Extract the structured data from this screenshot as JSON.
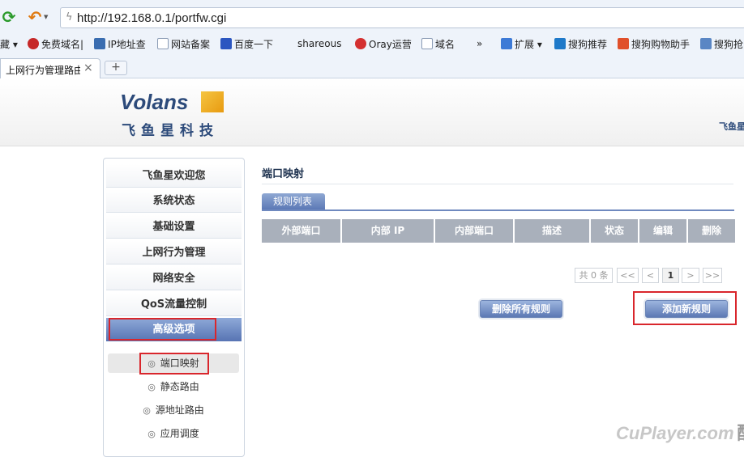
{
  "browser": {
    "url": "http://192.168.0.1/portfw.cgi",
    "bookmarks": [
      {
        "label": "藏 ▾",
        "icon": "bookmark-icon"
      },
      {
        "label": "免费域名|",
        "icon": "oray-icon"
      },
      {
        "label": "IP地址查",
        "icon": "ip-icon"
      },
      {
        "label": "网站备案",
        "icon": "page-icon"
      },
      {
        "label": "百度一下",
        "icon": "baidu-icon"
      },
      {
        "label": "shareous",
        "icon": ""
      },
      {
        "label": "Oray运营",
        "icon": "oray-icon"
      },
      {
        "label": "域名",
        "icon": "page-icon"
      },
      {
        "label": "»",
        "icon": ""
      },
      {
        "label": "扩展 ▾",
        "icon": "grid-icon"
      },
      {
        "label": "搜狗推荐",
        "icon": "search-icon"
      },
      {
        "label": "搜狗购物助手",
        "icon": "shop-icon"
      },
      {
        "label": "搜狗抢",
        "icon": "window-icon"
      }
    ],
    "tab": {
      "label": "上网行为管理路由",
      "close": "×"
    },
    "newtab": "+"
  },
  "header": {
    "logo_word": "Volans",
    "logo_cn": "飞鱼星科技",
    "right_text": "飞鱼星"
  },
  "sidebar": {
    "items": [
      {
        "label": "飞鱼星欢迎您"
      },
      {
        "label": "系统状态"
      },
      {
        "label": "基础设置"
      },
      {
        "label": "上网行为管理"
      },
      {
        "label": "网络安全"
      },
      {
        "label": "QoS流量控制"
      },
      {
        "label": "高级选项"
      }
    ],
    "sub_items": [
      {
        "label": "端口映射"
      },
      {
        "label": "静态路由"
      },
      {
        "label": "源地址路由"
      },
      {
        "label": "应用调度"
      }
    ],
    "bullet": "◎"
  },
  "main": {
    "title": "端口映射",
    "tab_label": "规则列表",
    "columns": [
      "外部端口",
      "内部 IP",
      "内部端口",
      "描述",
      "状态",
      "编辑",
      "删除"
    ],
    "pager": {
      "total": "共 0 条",
      "first": "<<",
      "prev": "<",
      "current": "1",
      "next": ">",
      "last": ">>"
    },
    "delete_all_label": "删除所有规则",
    "add_label": "添加新规则"
  },
  "watermark": {
    "latin": "CuPlayer.com",
    "cn": "酷播"
  },
  "colors": {
    "accent": "#5c79b6",
    "highlight": "#d9262c",
    "header_gray": "#a9b0bb"
  }
}
